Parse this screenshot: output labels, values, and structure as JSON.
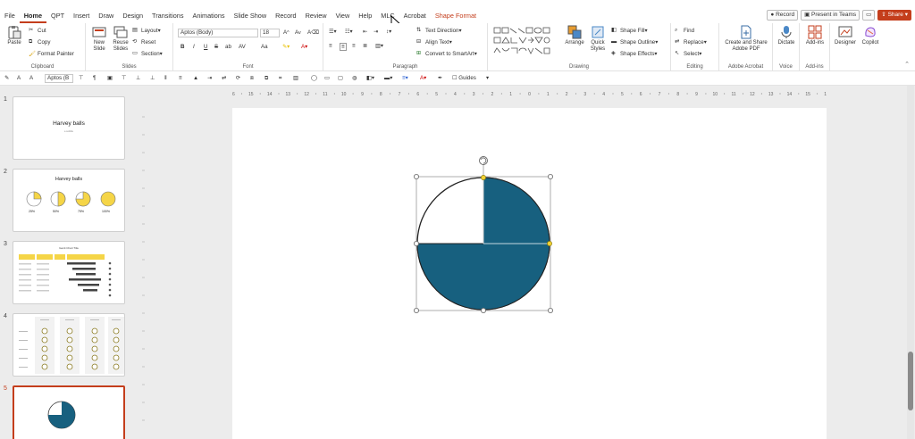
{
  "menu": {
    "tabs": [
      "File",
      "Home",
      "QPT",
      "Insert",
      "Draw",
      "Design",
      "Transitions",
      "Animations",
      "Slide Show",
      "Record",
      "Review",
      "View",
      "Help",
      "MLC",
      "Acrobat",
      "Shape Format"
    ],
    "record_label": "Record",
    "teams_label": "Present in Teams",
    "share_label": "Share"
  },
  "ribbon": {
    "clipboard": {
      "paste": "Paste",
      "cut": "Cut",
      "copy": "Copy",
      "format_painter": "Format Painter",
      "label": "Clipboard"
    },
    "slides": {
      "new_slide": "New Slide",
      "reuse_slides": "Reuse Slides",
      "layout": "Layout",
      "reset": "Reset",
      "section": "Section",
      "label": "Slides"
    },
    "font": {
      "name": "Aptos (Body)",
      "size": "18",
      "bold": "B",
      "italic": "I",
      "underline": "U",
      "strike": "S",
      "shadow": "ab",
      "spacing": "AV",
      "case": "Aa",
      "label": "Font"
    },
    "paragraph": {
      "text_direction": "Text Direction",
      "align_text": "Align Text",
      "convert_smartart": "Convert to SmartArt",
      "label": "Paragraph"
    },
    "drawing": {
      "arrange": "Arrange",
      "quick_styles": "Quick Styles",
      "shape_fill": "Shape Fill",
      "shape_outline": "Shape Outline",
      "shape_effects": "Shape Effects",
      "label": "Drawing"
    },
    "editing": {
      "find": "Find",
      "replace": "Replace",
      "select": "Select",
      "label": "Editing"
    },
    "acrobat": {
      "create_share": "Create and Share Adobe PDF",
      "label": "Adobe Acrobat"
    },
    "voice": {
      "dictate": "Dictate",
      "label": "Voice"
    },
    "addins": {
      "addins": "Add-ins",
      "label": "Add-ins"
    },
    "designer": "Designer",
    "copilot": "Copilot"
  },
  "quickbar": {
    "font_name": "Aptos (B",
    "guides": "Guides"
  },
  "ruler": {
    "ticks": [
      "16",
      "15",
      "14",
      "13",
      "12",
      "11",
      "10",
      "9",
      "8",
      "7",
      "6",
      "5",
      "4",
      "3",
      "2",
      "1",
      "0",
      "1",
      "2",
      "3",
      "4",
      "5",
      "6",
      "7",
      "8",
      "9",
      "10",
      "11",
      "12",
      "13",
      "14",
      "15",
      "16"
    ]
  },
  "slides": [
    {
      "number": "1",
      "title": "Harvey balls",
      "subtitle": "a subtitle"
    },
    {
      "number": "2",
      "title": "Harvey balls",
      "labels": [
        "25%",
        "50%",
        "75%",
        "100%"
      ]
    },
    {
      "number": "3",
      "title": "Gantt Chart Title"
    },
    {
      "number": "4"
    },
    {
      "number": "5"
    }
  ],
  "shape": {
    "fill_color": "#17607f",
    "fraction_filled": 0.75
  },
  "colors": {
    "accent": "#c43e1c",
    "yellow": "#f5d547",
    "navy": "#17607f"
  }
}
